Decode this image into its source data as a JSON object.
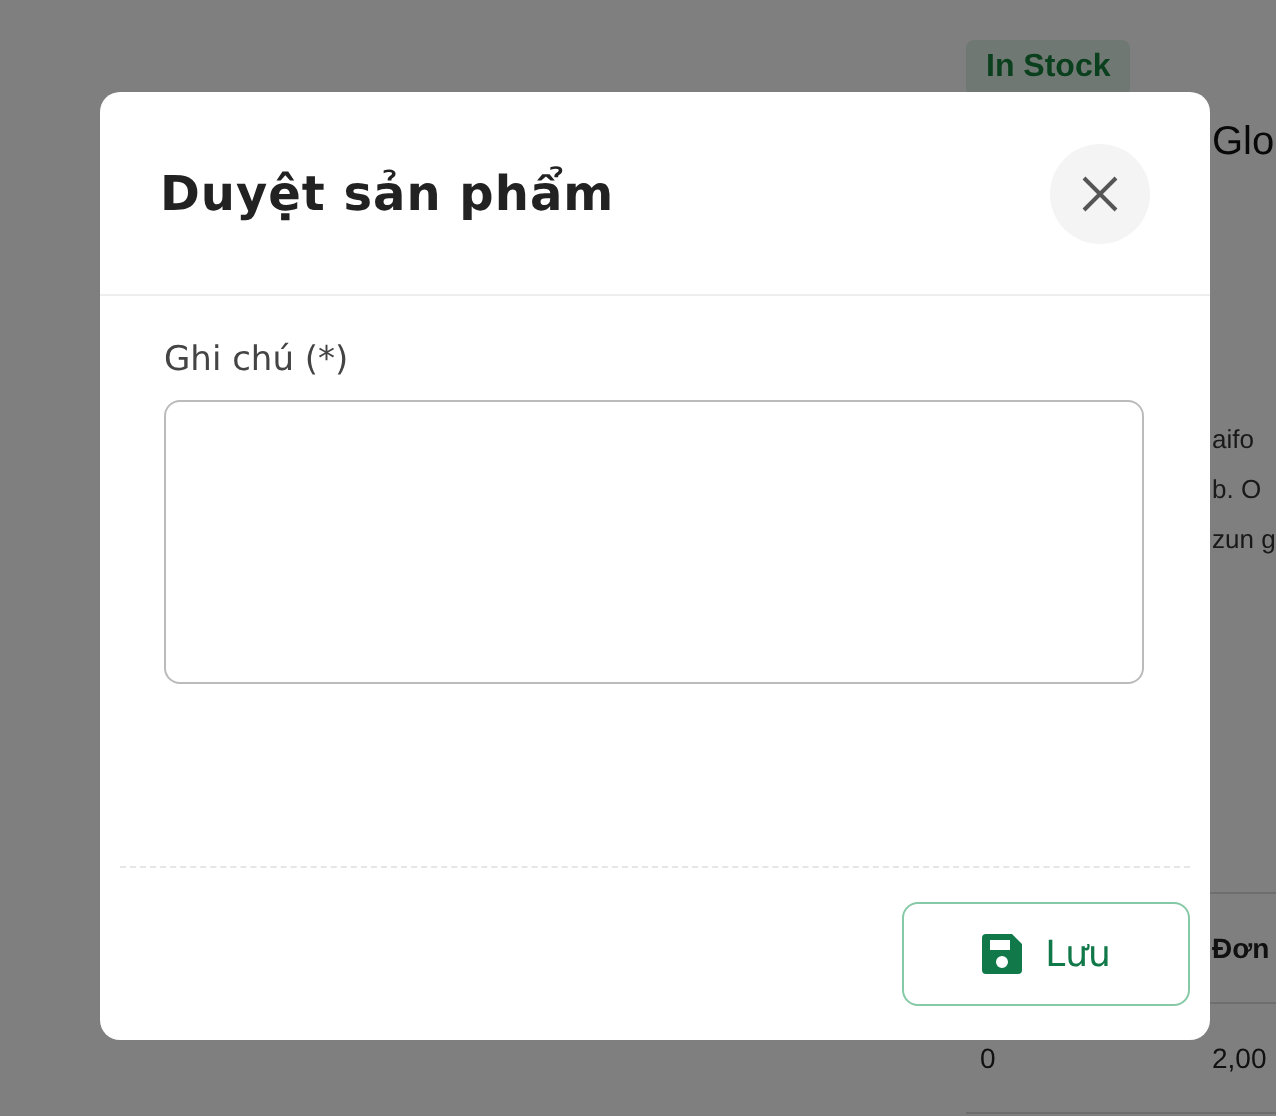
{
  "background_page": {
    "badge": "In Stock",
    "title": "Glo",
    "description_lines": [
      "aifo",
      "b. O",
      "zun g"
    ],
    "table": {
      "header": "Đơn",
      "rows": [
        {
          "column_1": "0",
          "column_2": "2,00"
        }
      ]
    }
  },
  "dialog": {
    "title": "Duyệt sản phẩm",
    "field": {
      "label": "Ghi chú (*)"
    },
    "buttons": [
      {
        "label": "Lưu",
        "kind": "save"
      }
    ]
  }
}
